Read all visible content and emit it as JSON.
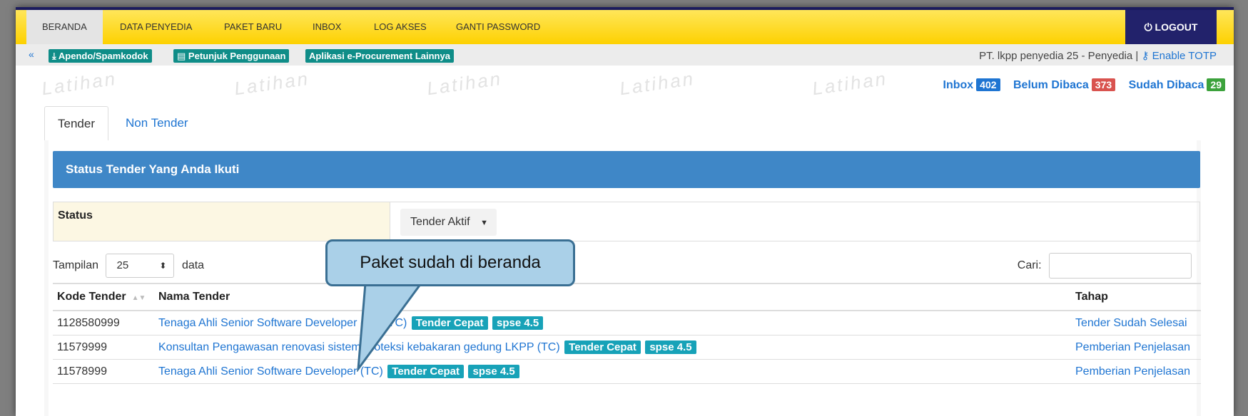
{
  "nav": {
    "items": [
      "BERANDA",
      "DATA PENYEDIA",
      "PAKET BARU",
      "INBOX",
      "LOG AKSES",
      "GANTI PASSWORD"
    ],
    "logout_label": "LOGOUT"
  },
  "subbar": {
    "link1": "Apendo/Spamkodok",
    "link2": "Petunjuk Penggunaan",
    "link3": "Aplikasi e-Procurement Lainnya",
    "user": "PT. lkpp penyedia 25 - Penyedia |",
    "enable_totp": "Enable TOTP"
  },
  "watermark": "Latihan",
  "inbox": {
    "inbox_label": "Inbox",
    "inbox_count": "402",
    "unread_label": "Belum Dibaca",
    "unread_count": "373",
    "read_label": "Sudah Dibaca",
    "read_count": "29"
  },
  "tabs": [
    "Tender",
    "Non Tender"
  ],
  "panel": {
    "title": "Status Tender Yang Anda Ikuti",
    "status_label": "Status",
    "status_value": "Tender Aktif",
    "length_prefix": "Tampilan",
    "length_value": "25",
    "length_suffix": "data",
    "search_label": "Cari:"
  },
  "table": {
    "headers": [
      "Kode Tender",
      "Nama Tender",
      "Tahap"
    ],
    "rows": [
      {
        "kode": "1128580999",
        "nama": "Tenaga Ahli Senior Software Developer (Test TC)",
        "tags": [
          "Tender Cepat",
          "spse 4.5"
        ],
        "tahap": "Tender Sudah Selesai"
      },
      {
        "kode": "11579999",
        "nama": "Konsultan Pengawasan renovasi sistem proteksi kebakaran gedung LKPP (TC)",
        "tags": [
          "Tender Cepat",
          "spse 4.5"
        ],
        "tahap": "Pemberian Penjelasan"
      },
      {
        "kode": "11578999",
        "nama": "Tenaga Ahli Senior Software Developer (TC)",
        "tags": [
          "Tender Cepat",
          "spse 4.5"
        ],
        "tahap": "Pemberian Penjelasan"
      }
    ]
  },
  "callout": "Paket sudah di beranda",
  "colors": {
    "topbar": "#fdd100",
    "logout": "#22226b",
    "header": "#3f87c7",
    "link": "#1f75d2",
    "tag": "#17a2b8",
    "callout": "#aad0e8"
  }
}
